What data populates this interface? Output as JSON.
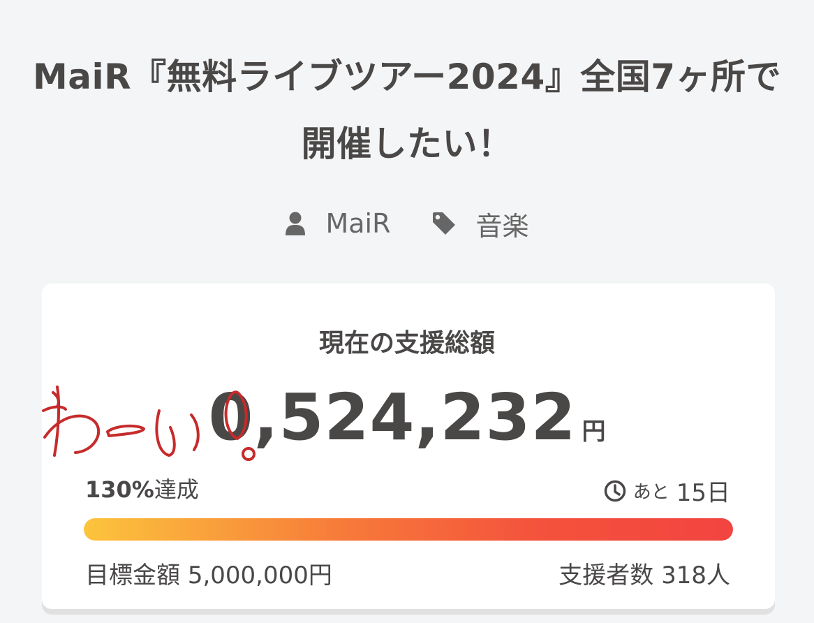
{
  "project": {
    "title": "MaiR『無料ライブツアー2024』全国7ヶ所で開催したい！",
    "owner": "MaiR",
    "category": "音楽",
    "owner_icon": "user-icon",
    "category_icon": "tag-icon"
  },
  "funding": {
    "label": "現在の支援総額",
    "amount": "0,524,232",
    "currency": "円",
    "achieved_percent": "130%",
    "achieved_suffix": "達成",
    "progress_fraction": 1.0,
    "remaining_prefix": "あと",
    "remaining_value": "15日",
    "remaining_icon": "clock-icon",
    "goal_label": "目標金額",
    "goal_value": "5,000,000円",
    "backers_label": "支援者数",
    "backers_value": "318人"
  },
  "annotation": {
    "handwritten_text": "わーい!",
    "color": "#c62b2b"
  },
  "colors": {
    "text": "#4a4747",
    "progress_start": "#fcc43c",
    "progress_end": "#f24440",
    "background": "#f4f5f6",
    "card": "#ffffff"
  }
}
